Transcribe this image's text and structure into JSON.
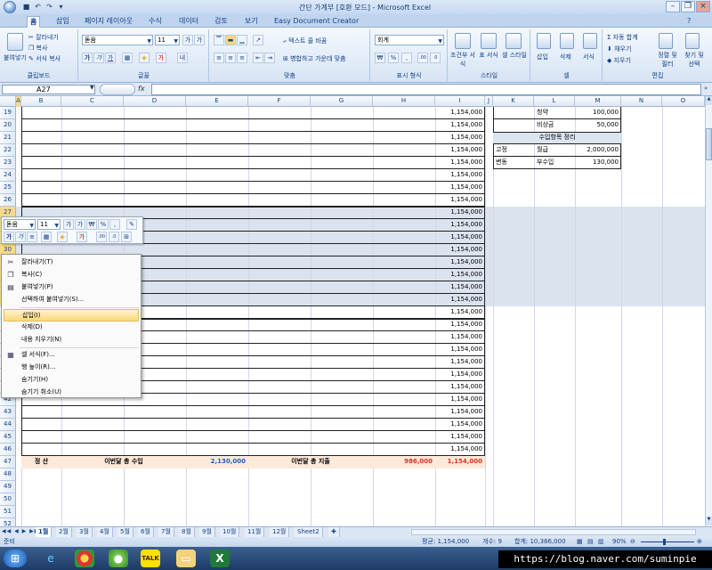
{
  "window": {
    "title": "간단 가계부 [호환 모드] - Microsoft Excel"
  },
  "ribbon_tabs": [
    "홈",
    "삽입",
    "페이지 레이아웃",
    "수식",
    "데이터",
    "검토",
    "보기",
    "Easy Document Creator"
  ],
  "ribbon": {
    "clipboard": {
      "paste": "붙여넣기",
      "cut": "잘라내기",
      "copy": "복사",
      "format_painter": "서식 복사",
      "label": "클립보드"
    },
    "font": {
      "name": "돋움",
      "size": "11",
      "label": "글꼴"
    },
    "alignment": {
      "wrap": "텍스트 줄 바꿈",
      "merge": "병합하고 가운데 맞춤",
      "label": "맞춤"
    },
    "number": {
      "format": "회계",
      "label": "표시 형식"
    },
    "styles": {
      "cond": "조건부 서식",
      "table": "표 서식",
      "cell": "셀 스타일",
      "label": "스타일"
    },
    "cells": {
      "insert": "삽입",
      "delete": "삭제",
      "format": "서식",
      "label": "셀"
    },
    "editing": {
      "autosum": "자동 합계",
      "fill": "채우기",
      "clear": "지우기",
      "sort": "정렬 및 필터",
      "find": "찾기 및 선택",
      "label": "편집"
    }
  },
  "formula_bar": {
    "name_box": "A27",
    "fx": "fx"
  },
  "columns": [
    "A",
    "B",
    "C",
    "D",
    "E",
    "F",
    "G",
    "H",
    "I",
    "J",
    "K",
    "L",
    "M",
    "N",
    "O"
  ],
  "rows": {
    "r19": {
      "num": "19",
      "I": "1,154,000",
      "L": "청약",
      "M": "100,000"
    },
    "r20": {
      "num": "20",
      "I": "1,154,000",
      "L": "비상금",
      "M": "50,000"
    },
    "r21": {
      "num": "21",
      "I": "1,154,000",
      "KM": "수입항목 정리"
    },
    "r22": {
      "num": "22",
      "I": "1,154,000",
      "K": "고정",
      "L": "월급",
      "M": "2,000,000"
    },
    "r23": {
      "num": "23",
      "I": "1,154,000",
      "K": "변동",
      "L": "부수입",
      "M": "130,000"
    },
    "r24": {
      "num": "24",
      "I": "1,154,000"
    },
    "r25": {
      "num": "25",
      "I": "1,154,000"
    },
    "r26": {
      "num": "26",
      "I": "1,154,000"
    },
    "r27": {
      "num": "27",
      "I": "1,154,000"
    },
    "r28": {
      "num": "28",
      "I": "1,154,000"
    },
    "r29": {
      "num": "29",
      "I": "1,154,000"
    },
    "r30": {
      "num": "30",
      "I": "1,154,000"
    },
    "r31": {
      "num": "31",
      "I": "1,154,000"
    },
    "r32": {
      "num": "32",
      "I": "1,154,000"
    },
    "r33": {
      "num": "33",
      "I": "1,154,000"
    },
    "r34": {
      "num": "34",
      "I": "1,154,000"
    },
    "r35": {
      "num": "35",
      "I": "1,154,000"
    },
    "r36": {
      "num": "36",
      "I": "1,154,000"
    },
    "r37": {
      "num": "37",
      "I": "1,154,000"
    },
    "r38": {
      "num": "38",
      "I": "1,154,000"
    },
    "r39": {
      "num": "39",
      "I": "1,154,000"
    },
    "r40": {
      "num": "40",
      "I": "1,154,000"
    },
    "r41": {
      "num": "41",
      "I": "1,154,000"
    },
    "r42": {
      "num": "42",
      "I": "1,154,000"
    },
    "r43": {
      "num": "43",
      "I": "1,154,000"
    },
    "r44": {
      "num": "44",
      "I": "1,154,000"
    },
    "r45": {
      "num": "45",
      "I": "1,154,000"
    },
    "r46": {
      "num": "46",
      "I": "1,154,000"
    },
    "r47": {
      "num": "47",
      "B": "정 산",
      "CD": "이번달 총 수입",
      "E": "2,130,000",
      "FG": "이번달 총 지출",
      "H": "986,000",
      "I": "1,154,000"
    },
    "r48": {
      "num": "48"
    },
    "r49": {
      "num": "49"
    },
    "r50": {
      "num": "50"
    },
    "r51": {
      "num": "51"
    },
    "r52": {
      "num": "52"
    }
  },
  "mini_toolbar": {
    "font": "돋움",
    "size": "11",
    "percent": "%"
  },
  "context_menu": [
    "잘라내기(T)",
    "복사(C)",
    "붙여넣기(P)",
    "선택하여 붙여넣기(S)...",
    "삽입(I)",
    "삭제(D)",
    "내용 지우기(N)",
    "셀 서식(F)...",
    "행 높이(R)...",
    "숨기기(H)",
    "숨기기 취소(U)"
  ],
  "sheet_tabs": [
    "1월",
    "2월",
    "3월",
    "4월",
    "5월",
    "6월",
    "7월",
    "8월",
    "9월",
    "10월",
    "11월",
    "12월",
    "Sheet2"
  ],
  "status_bar": {
    "ready": "준비",
    "average": "평균: 1,154,000",
    "count": "개수: 9",
    "sum": "합계: 10,386,000",
    "zoom": "90%"
  },
  "watermark": "https://blog.naver.com/suminpie",
  "colors": {
    "blue_value": "#1f5fbf",
    "red_value": "#e0301e",
    "summary_fill": "#fde9d9",
    "header_fill": "#dbe5f1"
  }
}
